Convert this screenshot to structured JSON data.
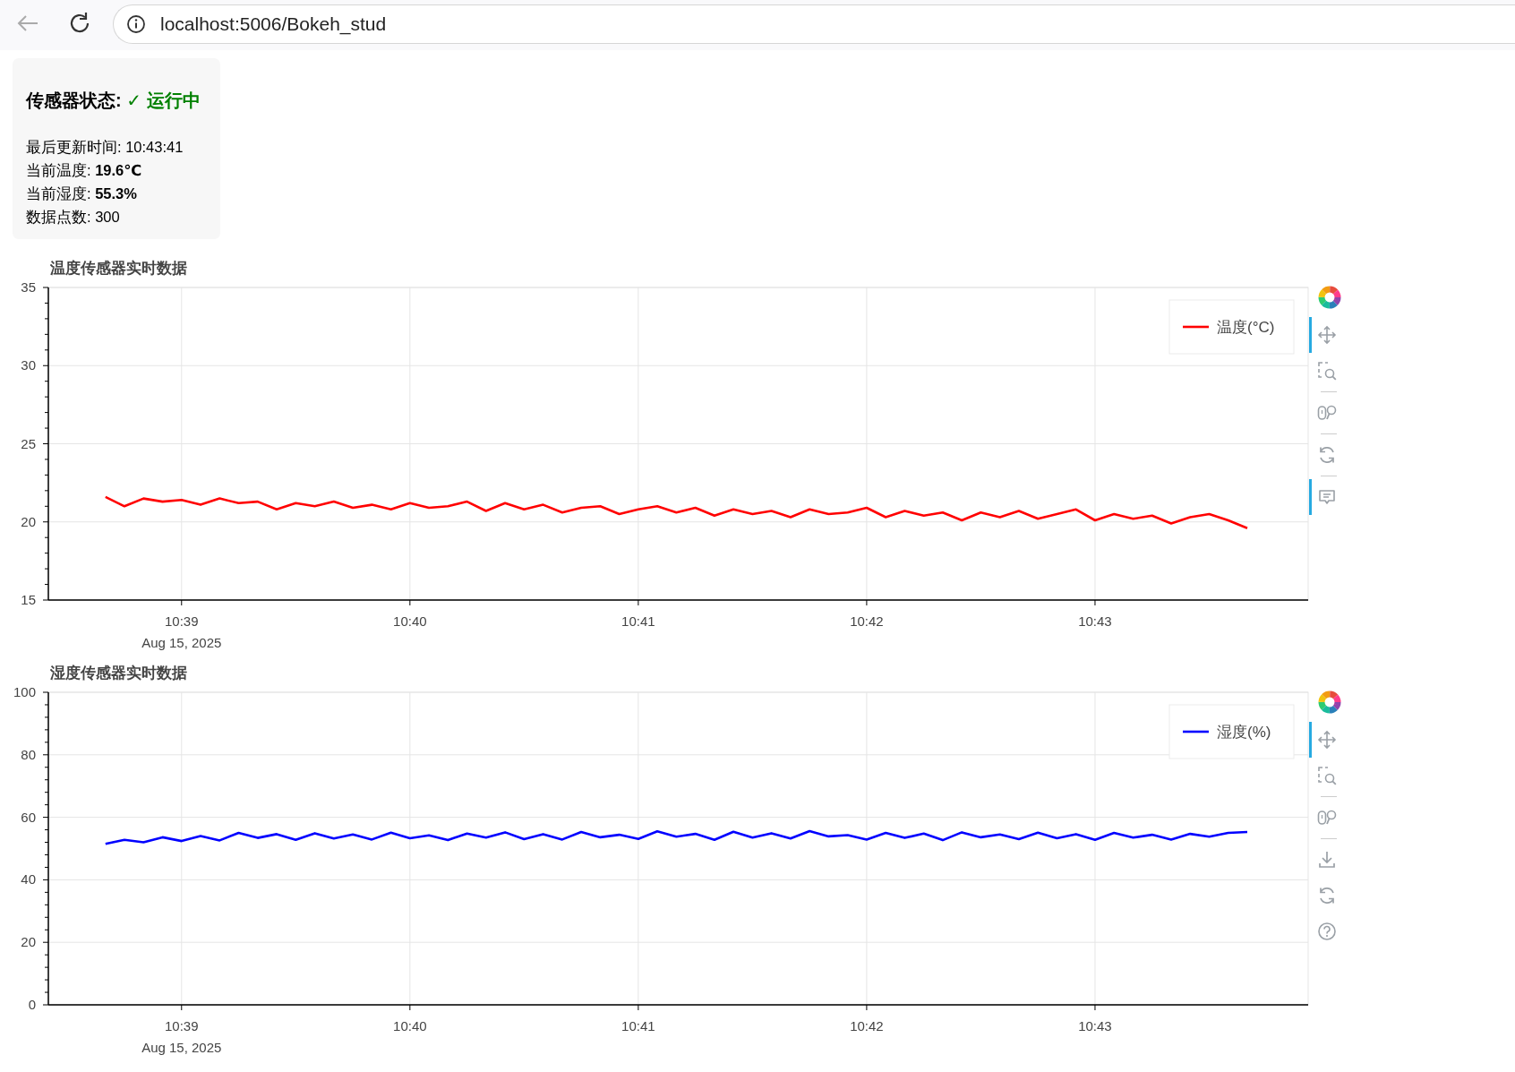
{
  "browser": {
    "url": "localhost:5006/Bokeh_stud"
  },
  "status_panel": {
    "title": "传感器状态:",
    "status": "✓ 运行中",
    "lines": [
      "最后更新时间: 10:43:41",
      "当前温度: **19.6℃**",
      "当前湿度: **55.3%**",
      "数据点数: 300"
    ]
  },
  "charts": [
    {
      "date_label": "Aug 15, 2025",
      "tool_groups": [
        [
          {
            "kind": "pan",
            "active": true
          },
          {
            "kind": "box_zoom",
            "active": false
          }
        ],
        [
          {
            "kind": "wheel_zoom",
            "active": false
          }
        ],
        [
          {
            "kind": "reset",
            "active": false
          }
        ],
        [
          {
            "kind": "hover",
            "active": true
          }
        ]
      ],
      "chart_data": {
        "type": "line",
        "title": "温度传感器实时数据",
        "categories": [
          null,
          null,
          null,
          null,
          "10:39",
          null,
          null,
          null,
          null,
          null,
          null,
          null,
          null,
          null,
          null,
          null,
          "10:40",
          null,
          null,
          null,
          null,
          null,
          null,
          null,
          null,
          null,
          null,
          null,
          "10:41",
          null,
          null,
          null,
          null,
          null,
          null,
          null,
          null,
          null,
          null,
          null,
          "10:42",
          null,
          null,
          null,
          null,
          null,
          null,
          null,
          null,
          null,
          null,
          null,
          "10:43",
          null,
          null,
          null,
          null,
          null,
          null,
          null,
          null
        ],
        "series": [
          {
            "name": "温度(°C)",
            "color": "#ff0000",
            "values": [
              21.6,
              21.0,
              21.5,
              21.3,
              21.4,
              21.1,
              21.5,
              21.2,
              21.3,
              20.8,
              21.2,
              21.0,
              21.3,
              20.9,
              21.1,
              20.8,
              21.2,
              20.9,
              21.0,
              21.3,
              20.7,
              21.2,
              20.8,
              21.1,
              20.6,
              20.9,
              21.0,
              20.5,
              20.8,
              21.0,
              20.6,
              20.9,
              20.4,
              20.8,
              20.5,
              20.7,
              20.3,
              20.8,
              20.5,
              20.6,
              20.9,
              20.3,
              20.7,
              20.4,
              20.6,
              20.1,
              20.6,
              20.3,
              20.7,
              20.2,
              20.5,
              20.8,
              20.1,
              20.5,
              20.2,
              20.4,
              19.9,
              20.3,
              20.5,
              20.1,
              19.6
            ]
          }
        ],
        "grid": true,
        "ylim": [
          15,
          35
        ],
        "yticks": [
          15,
          20,
          25,
          30,
          35
        ]
      }
    },
    {
      "date_label": "Aug 15, 2025",
      "tool_groups": [
        [
          {
            "kind": "pan",
            "active": true
          },
          {
            "kind": "box_zoom",
            "active": false
          }
        ],
        [
          {
            "kind": "wheel_zoom",
            "active": false
          }
        ],
        [
          {
            "kind": "save",
            "active": false
          },
          {
            "kind": "reset",
            "active": false
          },
          {
            "kind": "help",
            "active": false
          }
        ]
      ],
      "chart_data": {
        "type": "line",
        "title": "湿度传感器实时数据",
        "categories": [
          null,
          null,
          null,
          null,
          "10:39",
          null,
          null,
          null,
          null,
          null,
          null,
          null,
          null,
          null,
          null,
          null,
          "10:40",
          null,
          null,
          null,
          null,
          null,
          null,
          null,
          null,
          null,
          null,
          null,
          "10:41",
          null,
          null,
          null,
          null,
          null,
          null,
          null,
          null,
          null,
          null,
          null,
          "10:42",
          null,
          null,
          null,
          null,
          null,
          null,
          null,
          null,
          null,
          null,
          null,
          "10:43",
          null,
          null,
          null,
          null,
          null,
          null,
          null,
          null
        ],
        "series": [
          {
            "name": "湿度(%)",
            "color": "#0000ff",
            "values": [
              51.5,
              52.8,
              52.0,
              53.6,
              52.4,
              54.0,
              52.6,
              55.0,
              53.4,
              54.6,
              52.8,
              54.9,
              53.2,
              54.5,
              52.9,
              55.1,
              53.3,
              54.2,
              52.7,
              54.8,
              53.5,
              55.2,
              53.0,
              54.6,
              52.9,
              55.3,
              53.6,
              54.4,
              53.1,
              55.5,
              53.8,
              54.7,
              52.8,
              55.4,
              53.5,
              54.9,
              53.2,
              55.6,
              53.9,
              54.3,
              52.9,
              55.0,
              53.4,
              54.8,
              52.7,
              55.2,
              53.6,
              54.5,
              53.0,
              55.1,
              53.3,
              54.6,
              52.8,
              55.0,
              53.5,
              54.4,
              52.9,
              54.7,
              53.8,
              55.0,
              55.3
            ]
          }
        ],
        "grid": true,
        "ylim": [
          0,
          100
        ],
        "yticks": [
          0,
          20,
          40,
          60,
          80,
          100
        ]
      }
    }
  ]
}
